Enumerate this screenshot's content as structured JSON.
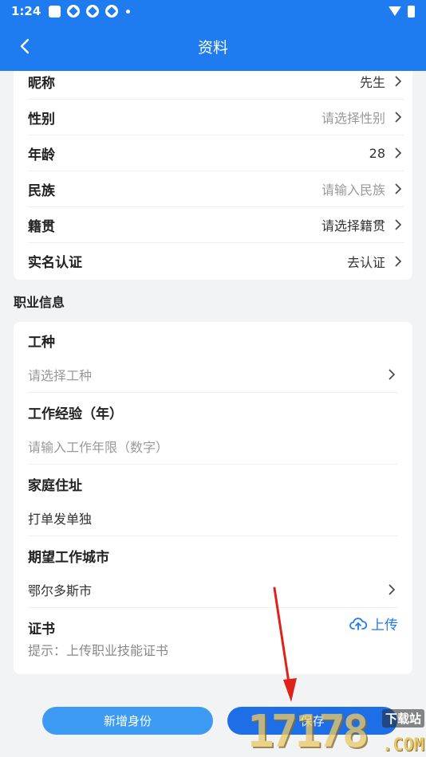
{
  "status": {
    "time": "1:24"
  },
  "header": {
    "title": "资料"
  },
  "basic": [
    {
      "label": "昵称",
      "value": "先生",
      "placeholder": false
    },
    {
      "label": "性别",
      "value": "请选择性别",
      "placeholder": true
    },
    {
      "label": "年龄",
      "value": "28",
      "placeholder": false
    },
    {
      "label": "民族",
      "value": "请输入民族",
      "placeholder": true
    },
    {
      "label": "籍贯",
      "value": "请选择籍贯",
      "placeholder": false
    },
    {
      "label": "实名认证",
      "value": "去认证",
      "placeholder": false
    }
  ],
  "section": {
    "title": "职业信息"
  },
  "job": {
    "work_type_label": "工种",
    "work_type_placeholder": "请选择工种",
    "experience_label": "工作经验（年）",
    "experience_placeholder": "请输入工作年限（数字）",
    "address_label": "家庭住址",
    "address_value": "打单发单独",
    "city_label": "期望工作城市",
    "city_value": "鄂尔多斯市",
    "cert_label": "证书",
    "upload_label": "上传",
    "cert_hint": "提示：上传职业技能证书"
  },
  "buttons": {
    "add_identity": "新增身份",
    "save": "保存"
  },
  "watermark": {
    "number": "17178",
    "site": "下载站",
    "domain": ".COM"
  },
  "colors": {
    "primary": "#1e7cf0",
    "add_button": "#3d9bf4",
    "annotation_arrow": "#e0211b"
  },
  "icons": {
    "back": "chevron-left-icon",
    "row": "chevron-right-icon",
    "upload": "cloud-upload-icon"
  }
}
